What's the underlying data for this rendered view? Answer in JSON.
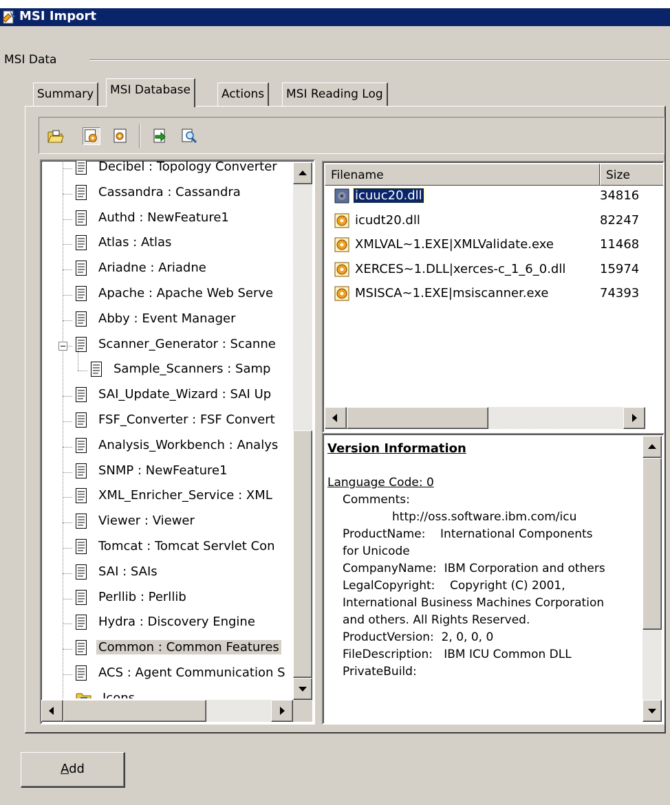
{
  "window": {
    "title": "MSI Import"
  },
  "group": {
    "label": "MSI Data"
  },
  "tabs": [
    {
      "label": "Summary",
      "active": false
    },
    {
      "label": "MSI Database",
      "active": true
    },
    {
      "label": "Actions",
      "active": false
    },
    {
      "label": "MSI Reading Log",
      "active": false
    }
  ],
  "toolbar": {
    "buttons": [
      {
        "icon": "open-folder-icon"
      },
      {
        "icon": "component-icon",
        "pressed": true
      },
      {
        "icon": "feature-icon"
      },
      {
        "icon": "import-icon"
      },
      {
        "icon": "search-icon"
      }
    ]
  },
  "tree": {
    "items": [
      {
        "label": "Decibel : Topology Converter",
        "level": 0
      },
      {
        "label": "Cassandra : Cassandra",
        "level": 0
      },
      {
        "label": "Authd : NewFeature1",
        "level": 0
      },
      {
        "label": "Atlas : Atlas",
        "level": 0
      },
      {
        "label": "Ariadne : Ariadne",
        "level": 0
      },
      {
        "label": "Apache : Apache Web Serve",
        "level": 0
      },
      {
        "label": "Abby : Event Manager",
        "level": 0
      },
      {
        "label": "Scanner_Generator : Scanne",
        "level": 0,
        "expanded": true
      },
      {
        "label": "Sample_Scanners : Samp",
        "level": 1
      },
      {
        "label": "SAI_Update_Wizard : SAI Up",
        "level": 0
      },
      {
        "label": "FSF_Converter : FSF Convert",
        "level": 0
      },
      {
        "label": "Analysis_Workbench : Analys",
        "level": 0
      },
      {
        "label": "SNMP : NewFeature1",
        "level": 0
      },
      {
        "label": "XML_Enricher_Service : XML",
        "level": 0
      },
      {
        "label": "Viewer : Viewer",
        "level": 0
      },
      {
        "label": "Tomcat : Tomcat Servlet Con",
        "level": 0
      },
      {
        "label": "SAI : SAIs",
        "level": 0
      },
      {
        "label": "Perllib : Perllib",
        "level": 0
      },
      {
        "label": "Hydra : Discovery Engine",
        "level": 0
      },
      {
        "label": "Common : Common Features",
        "level": 0,
        "selected": true
      },
      {
        "label": "ACS : Agent Communication S",
        "level": 0
      },
      {
        "label": "Icons",
        "level": 0,
        "folder": true
      }
    ]
  },
  "files": {
    "columns": [
      "Filename",
      "Size"
    ],
    "rows": [
      {
        "filename": "icuuc20.dll",
        "size": "34816",
        "selected": true
      },
      {
        "filename": "icudt20.dll",
        "size": "82247"
      },
      {
        "filename": "XMLVAL~1.EXE|XMLValidate.exe",
        "size": "11468"
      },
      {
        "filename": "XERCES~1.DLL|xerces-c_1_6_0.dll",
        "size": "15974"
      },
      {
        "filename": "MSISCA~1.EXE|msiscanner.exe",
        "size": "74393"
      }
    ]
  },
  "version_info": {
    "heading": "Version Information",
    "language": "Language Code: 0",
    "comments_label": "Comments:",
    "comments_value": "http://oss.software.ibm.com/icu",
    "product_name": "ProductName:    International Components for Unicode",
    "company_name": "CompanyName:  IBM Corporation and others",
    "legal_copyright": "LegalCopyright:    Copyright (C) 2001, International Business Machines Corporation and others. All Rights Reserved.",
    "product_version": "ProductVersion:  2, 0, 0, 0",
    "file_description": "FileDescription:   IBM ICU Common DLL",
    "private_build": "PrivateBuild:"
  },
  "add_button": {
    "mnemonic": "A",
    "rest": "dd"
  }
}
